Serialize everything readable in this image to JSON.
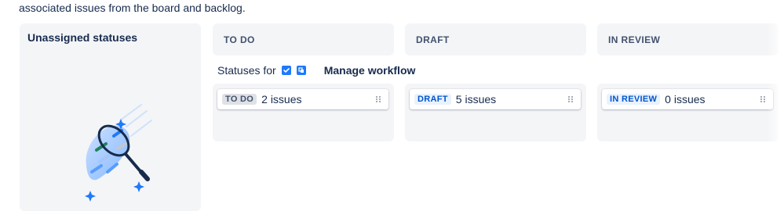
{
  "intro_text": "associated issues from the board and backlog.",
  "unassigned": {
    "title": "Unassigned statuses"
  },
  "columns": [
    {
      "header": "TO DO",
      "lozenge": "TO DO",
      "count_label": "2 issues"
    },
    {
      "header": "DRAFT",
      "lozenge": "DRAFT",
      "count_label": "5 issues"
    },
    {
      "header": "IN REVIEW",
      "lozenge": "IN REVIEW",
      "count_label": "0 issues"
    }
  ],
  "statuses_row": {
    "label": "Statuses for",
    "manage_label": "Manage workflow"
  },
  "colors": {
    "accent": "#1d7afc",
    "panel_bg": "#f4f5f7",
    "text": "#172b4d"
  }
}
